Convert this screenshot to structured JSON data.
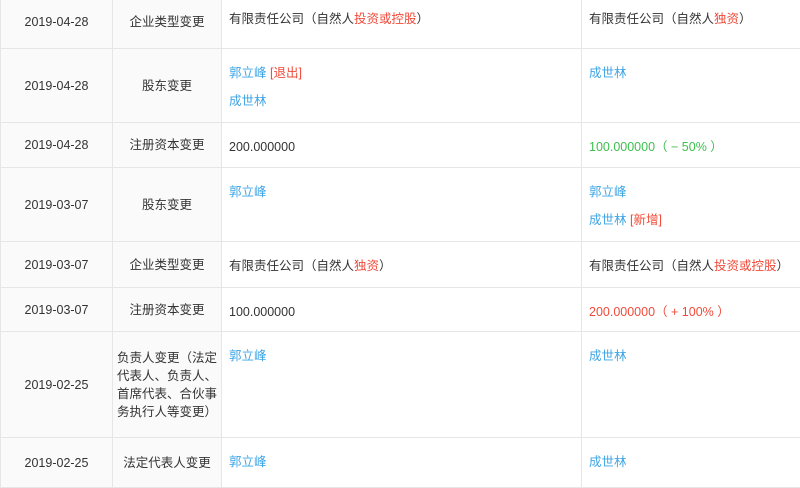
{
  "rows": [
    {
      "date": "2019-04-28",
      "type": "企业类型变更",
      "before": {
        "text": "有限责任公司（自然人",
        "highlight": "投资或控股",
        "suffix": "）"
      },
      "after": {
        "text": "有限责任公司（自然人",
        "highlight": "独资",
        "suffix": "）"
      }
    },
    {
      "date": "2019-04-28",
      "type": "股东变更",
      "before": [
        {
          "name": "郭立峰",
          "tag": "[退出]"
        },
        {
          "name": "成世林"
        }
      ],
      "after": [
        {
          "name": "成世林"
        }
      ]
    },
    {
      "date": "2019-04-28",
      "type": "注册资本变更",
      "before": "200.000000",
      "after": "100.000000（ − 50% ）"
    },
    {
      "date": "2019-03-07",
      "type": "股东变更",
      "before": [
        {
          "name": "郭立峰"
        }
      ],
      "after": [
        {
          "name": "郭立峰"
        },
        {
          "name": "成世林",
          "tag": "[新增]"
        }
      ]
    },
    {
      "date": "2019-03-07",
      "type": "企业类型变更",
      "before": {
        "text": "有限责任公司（自然人",
        "highlight": "独资",
        "suffix": "）"
      },
      "after": {
        "text": "有限责任公司（自然人",
        "highlight": "投资或控股",
        "suffix": "）"
      }
    },
    {
      "date": "2019-03-07",
      "type": "注册资本变更",
      "before": "100.000000",
      "after": "200.000000（ + 100% ）"
    },
    {
      "date": "2019-02-25",
      "type": "负责人变更（法定代表人、负责人、首席代表、合伙事务执行人等变更）",
      "before": [
        {
          "name": "郭立峰"
        }
      ],
      "after": [
        {
          "name": "成世林"
        }
      ]
    },
    {
      "date": "2019-02-25",
      "type": "法定代表人变更",
      "before": [
        {
          "name": "郭立峰"
        }
      ],
      "after": [
        {
          "name": "成世林"
        }
      ]
    }
  ],
  "colors": {
    "link": "#3ca4e6",
    "decrease": "#3dbf4e",
    "increase": "#f04b3a",
    "highlight": "#f04b3a",
    "border": "#e6e6e6"
  }
}
